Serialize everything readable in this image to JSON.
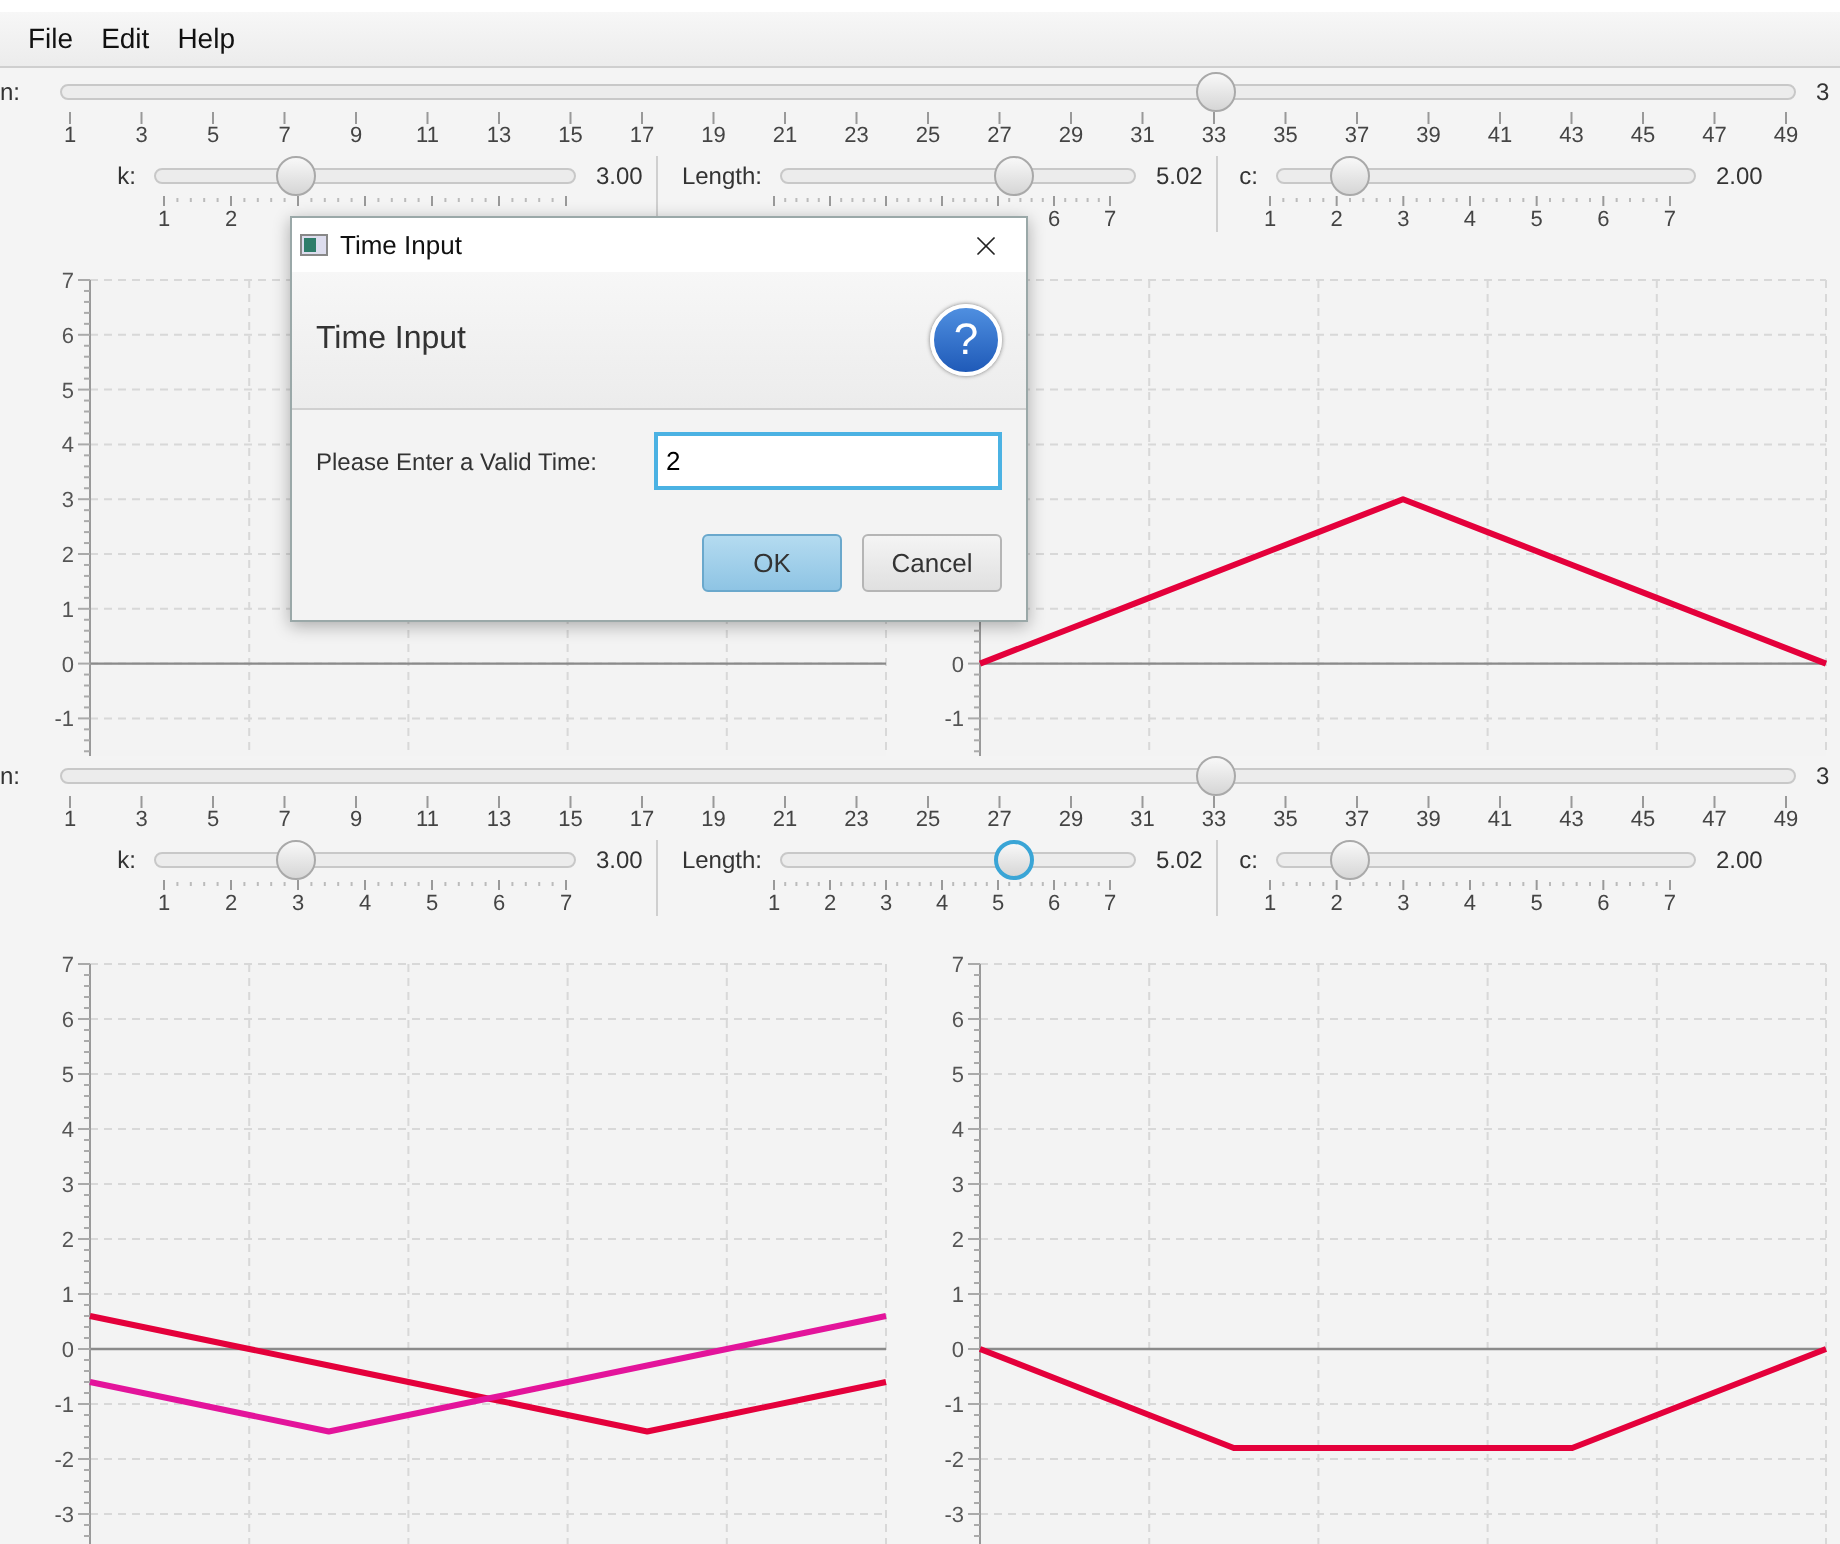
{
  "menu": [
    "File",
    "Edit",
    "Help"
  ],
  "panels": [
    {
      "n_slider": {
        "label": "n:",
        "level": 0.67,
        "value": "3",
        "focused": false,
        "ticks": [
          "1",
          "3",
          "5",
          "7",
          "9",
          "11",
          "13",
          "15",
          "17",
          "19",
          "21",
          "23",
          "25",
          "27",
          "29",
          "31",
          "33",
          "35",
          "37",
          "39",
          "41",
          "43",
          "45",
          "47",
          "49"
        ]
      },
      "sliders": [
        {
          "kind": "start",
          "label": "k:",
          "level": 0.32,
          "value": "3.00",
          "focused": false,
          "ticks": [
            "1",
            "2"
          ]
        },
        {
          "kind": "end",
          "label": "Length:",
          "level": 0.68,
          "value": "5.02",
          "focused": false,
          "ticks": [
            "6",
            "7"
          ]
        },
        {
          "kind": "start",
          "label": "c:",
          "level": 0.14,
          "value": "2.00",
          "focused": false,
          "ticks": [
            "1",
            "2",
            "3",
            "4",
            "5",
            "6",
            "7"
          ]
        }
      ],
      "charts": [
        {
          "chart_data": {
            "type": "line",
            "grid": true,
            "ylim": [
              -1.7,
              7
            ],
            "yticks": [
              -1,
              0,
              1,
              2,
              3,
              4,
              5,
              6,
              7
            ],
            "categories": [
              null,
              null,
              null,
              null,
              null,
              null,
              null,
              null,
              null,
              null,
              null
            ]
          }
        },
        {
          "chart_data": {
            "type": "line",
            "grid": true,
            "ylim": [
              -1.7,
              7
            ],
            "yticks": [
              -1,
              0
            ],
            "categories": [
              null,
              null,
              null,
              null,
              null,
              null,
              null,
              null,
              null,
              null,
              null
            ],
            "series": [
              {
                "color": "#e4003b",
                "values": [
                  0,
                  0.6,
                  1.2,
                  1.8,
                  2.4,
                  3,
                  2.4,
                  1.8,
                  1.2,
                  0.6,
                  0
                ]
              }
            ]
          }
        }
      ]
    },
    {
      "n_slider": {
        "label": "n:",
        "level": 0.67,
        "value": "3",
        "focused": false,
        "ticks": [
          "1",
          "3",
          "5",
          "7",
          "9",
          "11",
          "13",
          "15",
          "17",
          "19",
          "21",
          "23",
          "25",
          "27",
          "29",
          "31",
          "33",
          "35",
          "37",
          "39",
          "41",
          "43",
          "45",
          "47",
          "49"
        ]
      },
      "sliders": [
        {
          "kind": "start",
          "label": "k:",
          "level": 0.32,
          "value": "3.00",
          "focused": false,
          "ticks": [
            "1",
            "2",
            "3",
            "4",
            "5",
            "6",
            "7"
          ]
        },
        {
          "kind": "start",
          "label": "Length:",
          "level": 0.68,
          "value": "5.02",
          "focused": true,
          "ticks": [
            "1",
            "2",
            "3",
            "4",
            "5",
            "6",
            "7"
          ]
        },
        {
          "kind": "start",
          "label": "c:",
          "level": 0.14,
          "value": "2.00",
          "focused": false,
          "ticks": [
            "1",
            "2",
            "3",
            "4",
            "5",
            "6",
            "7"
          ]
        }
      ],
      "charts": [
        {
          "chart_data": {
            "type": "line",
            "grid": true,
            "ylim": [
              -3.5,
              7
            ],
            "yticks": [
              -3,
              -2,
              -1,
              0,
              1,
              2,
              3,
              4,
              5,
              6,
              7
            ],
            "categories": [
              null,
              null,
              null,
              null,
              null,
              null,
              null,
              null,
              null,
              null,
              null
            ],
            "series": [
              {
                "color": "#e4003b",
                "values": [
                  0.6,
                  0.3,
                  0,
                  -0.3,
                  -0.6,
                  -0.9,
                  -1.2,
                  -1.5,
                  -1.2,
                  -0.9,
                  -0.6
                ]
              },
              {
                "color": "#e3149b",
                "values": [
                  -0.6,
                  -0.9,
                  -1.2,
                  -1.5,
                  -1.2,
                  -0.9,
                  -0.6,
                  -0.3,
                  0,
                  0.3,
                  0.6
                ]
              }
            ]
          }
        },
        {
          "chart_data": {
            "type": "line",
            "grid": true,
            "ylim": [
              -3.5,
              7
            ],
            "yticks": [
              -3,
              -2,
              -1,
              0,
              1,
              2,
              3,
              4,
              5,
              6,
              7
            ],
            "categories": [
              null,
              null,
              null,
              null,
              null,
              null,
              null,
              null,
              null,
              null,
              null
            ],
            "series": [
              {
                "color": "#e4003b",
                "values": [
                  0,
                  -0.6,
                  -1.2,
                  -1.8,
                  -1.8,
                  -1.8,
                  -1.8,
                  -1.8,
                  -1.2,
                  -0.6,
                  0
                ]
              }
            ]
          }
        }
      ]
    }
  ],
  "dialog": {
    "title": "Time Input",
    "header": "Time Input",
    "help_glyph": "?",
    "prompt": "Please Enter a Valid Time:",
    "input": {
      "value": "2",
      "focused": true
    },
    "buttons": [
      {
        "label": "OK",
        "default": true
      },
      {
        "label": "Cancel",
        "default": false
      }
    ]
  }
}
